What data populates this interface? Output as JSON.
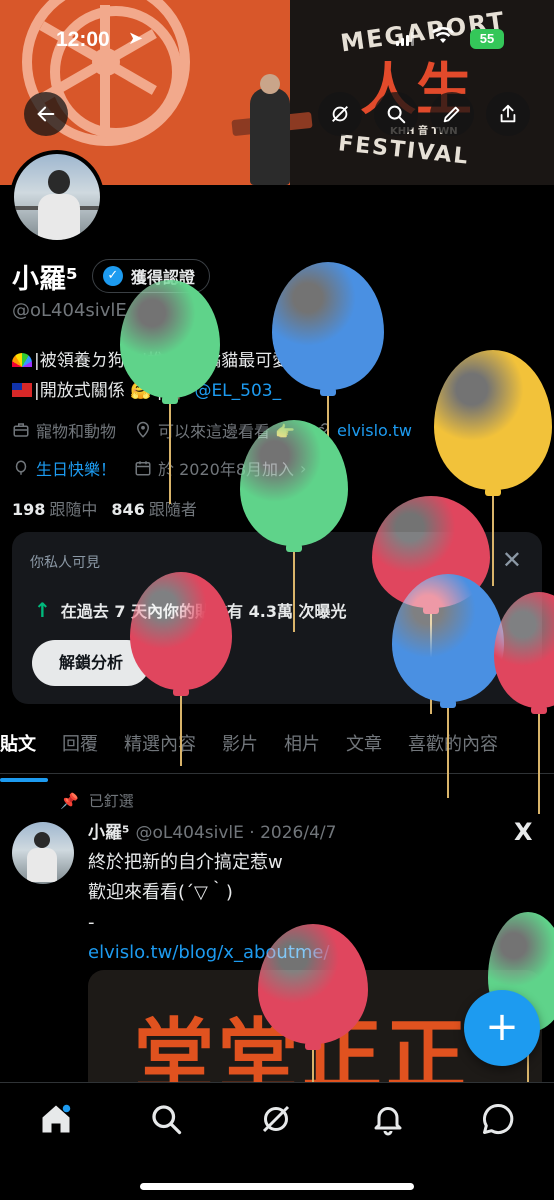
{
  "status_bar": {
    "time": "12:00",
    "battery": "55"
  },
  "banner": {
    "festival_top": "MEGAPORT",
    "festival_cn": "人生",
    "festival_sub": "KHH 音 TWN",
    "festival_bottom": "FESTIVAL"
  },
  "profile": {
    "display_name": "小羅⁵",
    "verified_label": "獲得認證",
    "handle": "@oL404sivlE",
    "bio_line1": "|被領養ㄉ狗勾|推止推|橘貓最可愛ㄉ！",
    "bio_line2_a": "|開放式關係",
    "bio_line2_b": "|",
    "bio_mention": "@EL_503_",
    "category": "寵物和動物",
    "location": "可以來這邊看看 👉",
    "website": "elvislo.tw",
    "birthday": "生日快樂！",
    "joined": "於 2020年8月加入",
    "following_count": "198",
    "following_label": "跟隨中",
    "followers_count": "846",
    "followers_label": "跟隨者"
  },
  "analytics_card": {
    "private_label": "你私人可見",
    "stat_text": "在過去 7 天內你的貼文有 4.3萬 次曝光",
    "unlock_button": "解鎖分析"
  },
  "tabs": [
    "貼文",
    "回覆",
    "精選內容",
    "影片",
    "相片",
    "文章",
    "喜歡的內容"
  ],
  "pinned_post": {
    "pinned_label": "已釘選",
    "author": "小羅⁵",
    "handle_date": "@oL404sivlE · 2026/4/7",
    "line1": "終於把新的自介搞定惹w",
    "line2": "歡迎來看看(´▽｀)",
    "line3": "-",
    "link": "elvislo.tw/blog/x_aboutme/",
    "media_text": "堂堂正正",
    "x_logo": "X"
  },
  "fab_label": "+",
  "bottom_nav": [
    "home-icon",
    "search-icon",
    "grok-icon",
    "notifications-icon",
    "messages-icon"
  ],
  "colors": {
    "accent": "#1d9bf0",
    "background": "#000000",
    "balloon_green": "#5fd38a",
    "balloon_blue": "#4a90e2",
    "balloon_yellow": "#f2c23a",
    "balloon_red": "#e0465e"
  }
}
